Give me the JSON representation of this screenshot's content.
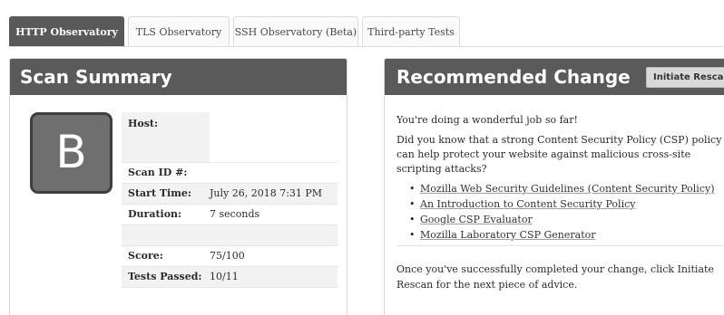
{
  "tabs": [
    {
      "label": "HTTP Observatory",
      "active": true
    },
    {
      "label": "TLS Observatory",
      "active": false
    },
    {
      "label": "SSH Observatory (Beta)",
      "active": false
    },
    {
      "label": "Third-party Tests",
      "active": false
    }
  ],
  "summary": {
    "title": "Scan Summary",
    "grade": "B",
    "rows": {
      "host": {
        "key": "Host:",
        "value": ""
      },
      "scan_id": {
        "key": "Scan ID #:",
        "value": ""
      },
      "start_time": {
        "key": "Start Time:",
        "value": "July 26, 2018 7:31 PM"
      },
      "duration": {
        "key": "Duration:",
        "value": "7 seconds"
      },
      "score": {
        "key": "Score:",
        "value": "75/100"
      },
      "tests_passed": {
        "key": "Tests Passed:",
        "value": "10/11"
      }
    }
  },
  "recommended": {
    "title": "Recommended Change",
    "rescan_label": "Initiate Rescan",
    "intro": "You're doing a wonderful job so far!",
    "question": "Did you know that a strong Content Security Policy (CSP) policy can help protect your website against malicious cross-site scripting attacks?",
    "links": [
      "Mozilla Web Security Guidelines (Content Security Policy)",
      "An Introduction to Content Security Policy",
      "Google CSP Evaluator",
      "Mozilla Laboratory CSP Generator"
    ],
    "footer": "Once you've successfully completed your change, click Initiate Rescan for the next piece of advice."
  },
  "colors": {
    "header_bg": "#5a5a5a",
    "grade_bg": "#6f6f6f",
    "active_tab": "#595959"
  }
}
